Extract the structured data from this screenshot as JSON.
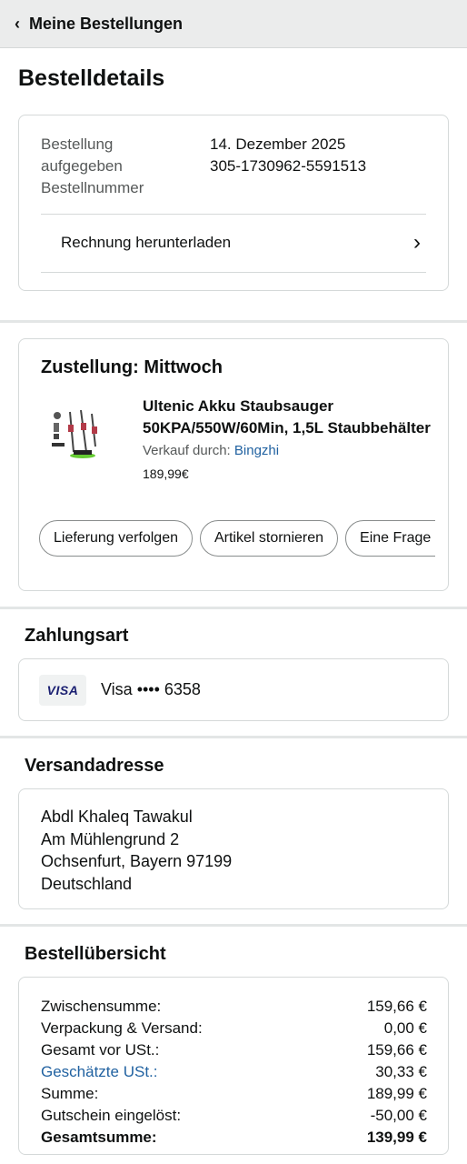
{
  "topbar": {
    "back_icon": "chevron-left-icon",
    "title": "Meine Bestellungen"
  },
  "page_title": "Bestelldetails",
  "order": {
    "placed_label": "Bestellung aufgegeben",
    "placed_label_line1": "Bestellung",
    "placed_label_line2": "aufgegeben",
    "placed_value": "14. Dezember 2025",
    "number_label": "Bestellnummer",
    "number_value": "305-1730962-5591513",
    "invoice_label": "Rechnung herunterladen"
  },
  "delivery": {
    "title": "Zustellung: Mittwoch",
    "product_title_line1": "Ultenic Akku Staubsauger",
    "product_title_line2": "50KPA/550W/60Min, 1,5L Staubbehälter",
    "seller_prefix": "Verkauf durch:",
    "seller_name": "Bingzhi",
    "price": "189,99€",
    "buttons": [
      "Lieferung verfolgen",
      "Artikel stornieren",
      "Eine Frage stellen"
    ]
  },
  "payment": {
    "title": "Zahlungsart",
    "card_brand": "VISA",
    "card_text": "Visa •••• 6358"
  },
  "address": {
    "title": "Versandadresse",
    "lines": [
      "Abdl Khaleq Tawakul",
      "Am Mühlengrund 2",
      "Ochsenfurt, Bayern 97199",
      "Deutschland"
    ]
  },
  "summary": {
    "title": "Bestellübersicht",
    "rows": [
      {
        "label": "Zwischensumme:",
        "value": "159,66 €"
      },
      {
        "label": "Verpackung & Versand:",
        "value": "0,00 €"
      },
      {
        "label": "Gesamt vor USt.:",
        "value": "159,66 €"
      },
      {
        "label": "Geschätzte USt.:",
        "value": "30,33 €"
      },
      {
        "label": "Summe:",
        "value": "189,99 €"
      },
      {
        "label": "Gutschein eingelöst:",
        "value": "-50,00 €"
      },
      {
        "label": "Gesamtsumme:",
        "value": "139,99 €"
      }
    ]
  },
  "colors": {
    "link": "#2162a1",
    "visa": "#1a1f71",
    "border": "#d5d9d9"
  }
}
